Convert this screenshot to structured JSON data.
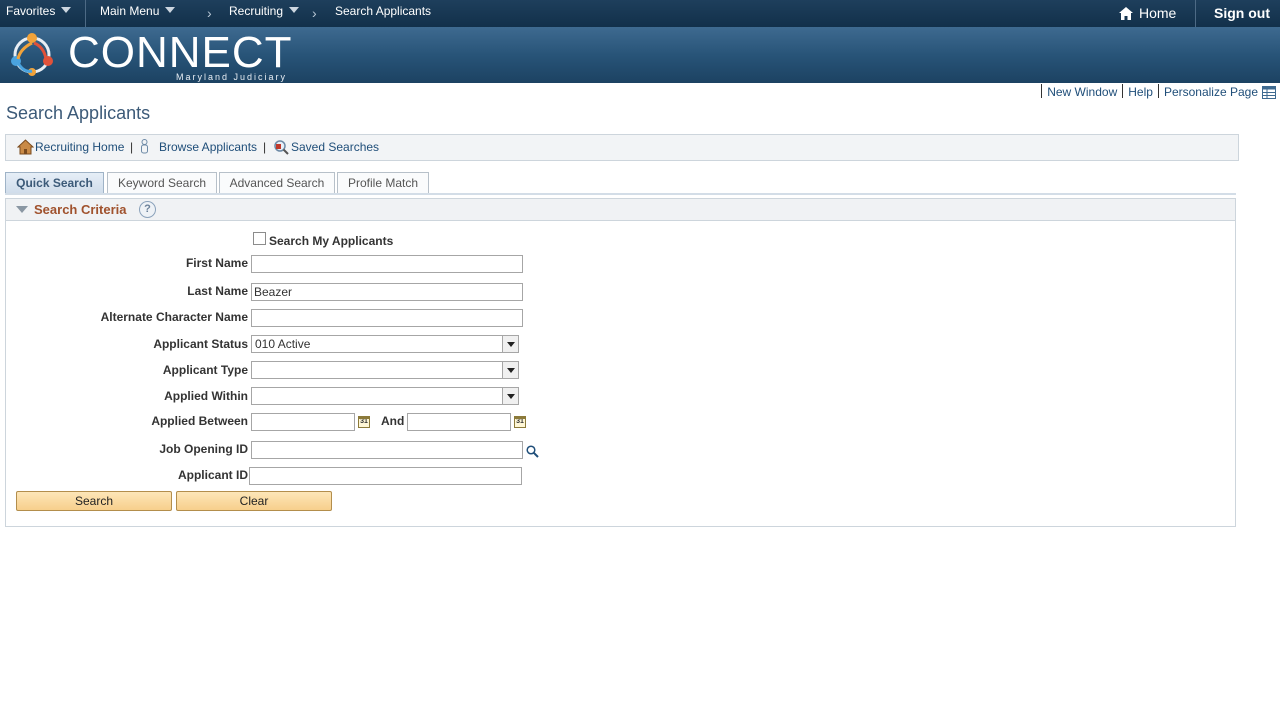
{
  "nav": {
    "favorites": "Favorites",
    "main_menu": "Main Menu",
    "breadcrumb_recruiting": "Recruiting",
    "breadcrumb_current": "Search Applicants",
    "home": "Home",
    "sign_out": "Sign out"
  },
  "banner": {
    "brand": "CONNECT",
    "subtitle": "Maryland Judiciary"
  },
  "pagebar": {
    "new_window": "New Window",
    "help": "Help",
    "personalize": "Personalize Page"
  },
  "page_title": "Search Applicants",
  "toolbar": {
    "recruiting_home": "Recruiting Home",
    "browse_applicants": "Browse Applicants",
    "saved_searches": "Saved Searches",
    "pipe": "|"
  },
  "tabs": [
    {
      "label": "Quick Search",
      "active": true
    },
    {
      "label": "Keyword Search",
      "active": false
    },
    {
      "label": "Advanced Search",
      "active": false
    },
    {
      "label": "Profile Match",
      "active": false
    }
  ],
  "criteria": {
    "title": "Search Criteria",
    "help": "?",
    "search_my_applicants": "Search My Applicants",
    "first_name_label": "First Name",
    "first_name_value": "",
    "last_name_label": "Last Name",
    "last_name_value": "Beazer",
    "alt_name_label": "Alternate Character Name",
    "alt_name_value": "",
    "status_label": "Applicant Status",
    "status_value": "010 Active",
    "type_label": "Applicant Type",
    "type_value": "",
    "within_label": "Applied Within",
    "within_value": "",
    "between_label": "Applied Between",
    "and_label": "And",
    "job_opening_label": "Job Opening ID",
    "applicant_id_label": "Applicant ID",
    "calendar_glyph": "31"
  },
  "buttons": {
    "search": "Search",
    "clear": "Clear"
  },
  "colors": {
    "nav_bg": "#12304a",
    "banner_bg": "#285478",
    "link": "#1f4e79",
    "group_title": "#a0522d",
    "button_bg": "#f7cf8c"
  }
}
